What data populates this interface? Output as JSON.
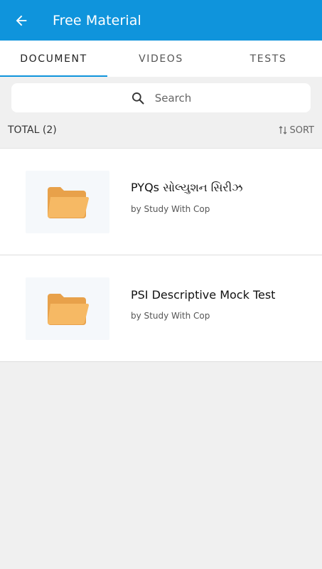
{
  "header": {
    "title": "Free Material",
    "back_icon": "arrow-left-icon",
    "background_color": "#0f94dc"
  },
  "tabs": [
    {
      "label": "DOCUMENT",
      "active": true
    },
    {
      "label": "VIDEOS",
      "active": false
    },
    {
      "label": "TESTS",
      "active": false
    }
  ],
  "search": {
    "placeholder": "Search",
    "icon": "search-icon"
  },
  "list_meta": {
    "total_label": "TOTAL (2)",
    "sort_label": "SORT",
    "sort_icon": "sort-arrows-icon"
  },
  "items": [
    {
      "title": "PYQs સોલ્યુશન સિરીઝ",
      "author": "by Study With Cop",
      "icon": "folder-icon"
    },
    {
      "title": "PSI Descriptive Mock Test",
      "author": "by Study With Cop",
      "icon": "folder-icon"
    }
  ],
  "colors": {
    "accent": "#0f94dc",
    "folder": "#f3b25e"
  }
}
